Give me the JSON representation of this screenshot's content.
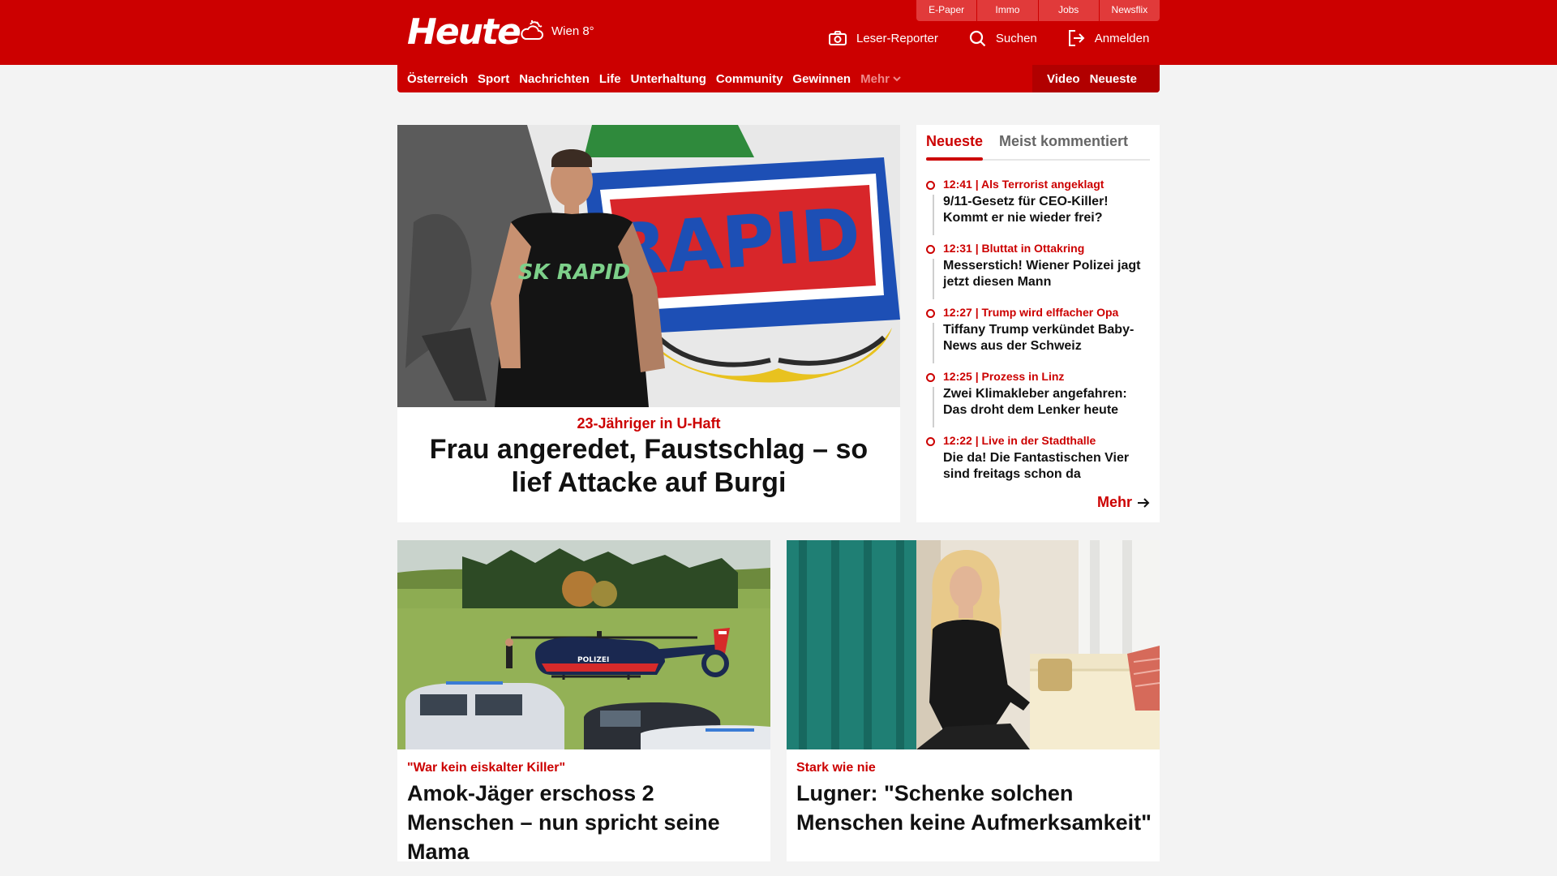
{
  "header": {
    "logo": "Heute",
    "weather": "Wien 8°",
    "top_links": [
      "E-Paper",
      "Immo",
      "Jobs",
      "Newsflix"
    ],
    "leser_reporter": "Leser-Reporter",
    "search": "Suchen",
    "login": "Anmelden"
  },
  "nav": {
    "items": [
      "Österreich",
      "Sport",
      "Nachrichten",
      "Life",
      "Unterhaltung",
      "Community",
      "Gewinnen"
    ],
    "more": "Mehr",
    "right": [
      "Video",
      "Neueste"
    ]
  },
  "hero": {
    "kicker": "23-Jähriger in U-Haft",
    "title": "Frau angeredet, Faustschlag – so lief Attacke auf Burgi",
    "image_text": "RAPID",
    "shirt_text": "SK RAPID"
  },
  "sidebar": {
    "tabs": [
      "Neueste",
      "Meist kommentiert"
    ],
    "items": [
      {
        "meta": "12:41 | Als Terrorist angeklagt",
        "title": "9/11-Gesetz für CEO-Killer! Kommt er nie wieder frei?"
      },
      {
        "meta": "12:31 | Bluttat in Ottakring",
        "title": "Messerstich! Wiener Polizei jagt jetzt diesen Mann"
      },
      {
        "meta": "12:27 | Trump wird elffacher Opa",
        "title": "Tiffany Trump verkündet Baby-News aus der Schweiz"
      },
      {
        "meta": "12:25 | Prozess in Linz",
        "title": "Zwei Klimakleber angefahren: Das droht dem Lenker heute"
      },
      {
        "meta": "12:22 | Live in der Stadthalle",
        "title": "Die da! Die Fantastischen Vier sind freitags schon da"
      }
    ],
    "more": "Mehr"
  },
  "cards": [
    {
      "kicker": "\"War kein eiskalter Killer\"",
      "title": "Amok-Jäger erschoss 2 Menschen – nun spricht seine Mama",
      "image_text": "POLIZEI"
    },
    {
      "kicker": "Stark wie nie",
      "title": "Lugner: \"Schenke solchen Menschen keine Aufmerksamkeit\""
    }
  ],
  "colors": {
    "brand": "#cc0000",
    "nav_dark": "#b10000",
    "background": "#f3f3f3"
  }
}
